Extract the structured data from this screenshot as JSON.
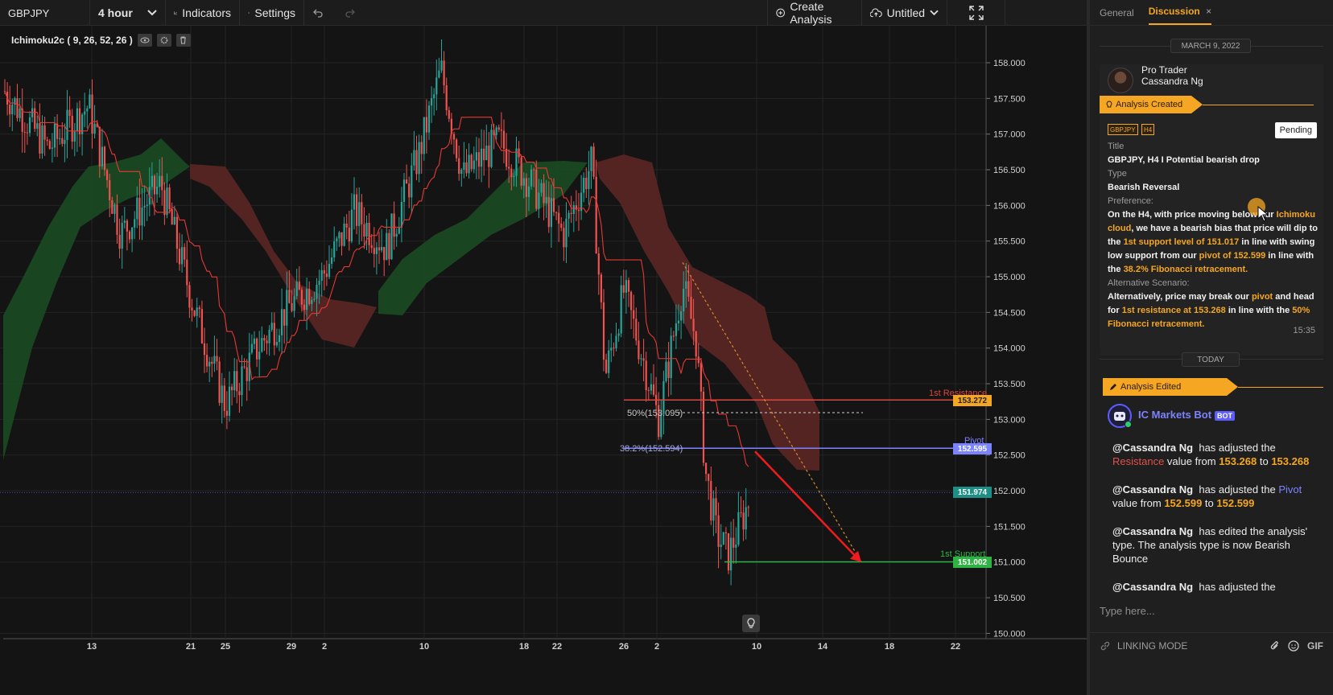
{
  "toolbar": {
    "symbol": "GBPJPY",
    "interval": "4 hour",
    "indicators_label": "Indicators",
    "settings_label": "Settings",
    "create_analysis_label": "Create Analysis",
    "layout_name": "Untitled"
  },
  "indicator": {
    "name": "Ichimoku2c ( 9, 26, 52, 26 )"
  },
  "chart_data": {
    "type": "candlestick",
    "symbol": "GBPJPY",
    "interval": "4 hour",
    "price_axis": [
      "158.000",
      "157.500",
      "157.000",
      "156.500",
      "156.000",
      "155.500",
      "155.000",
      "154.500",
      "154.000",
      "153.500",
      "153.000",
      "152.500",
      "152.000",
      "151.500",
      "151.000",
      "150.500",
      "150.000"
    ],
    "price_axis_values": [
      158.0,
      157.5,
      157.0,
      156.5,
      156.0,
      155.5,
      155.0,
      154.5,
      154.0,
      153.5,
      153.0,
      152.5,
      152.0,
      151.5,
      151.0,
      150.5,
      150.0
    ],
    "ylim": [
      149.93,
      158.11
    ],
    "date_axis": [
      "13",
      "21",
      "25",
      "29",
      "2",
      "10",
      "18",
      "22",
      "26",
      "2",
      "10",
      "14",
      "18",
      "22"
    ],
    "price_tags": {
      "resistance": "153.272",
      "pivot": "152.595",
      "current": "151.974",
      "support": "151.002"
    },
    "levels": {
      "resistance": {
        "label": "1st Resistance",
        "value": 153.272,
        "color": "#d9463d"
      },
      "pivot": {
        "label": "Pivot",
        "value": 152.595,
        "color": "#7c83ff"
      },
      "support": {
        "label": "1st Support",
        "value": 151.002,
        "color": "#2fb344"
      },
      "fib_50": {
        "label": "50%(153.095)",
        "value": 153.095
      },
      "fib_382": {
        "label": "38.2%(152.594)",
        "value": 152.594
      }
    },
    "colors": {
      "up": "#26a69a",
      "down": "#ef5350",
      "kumo_bull": "#1b4a22",
      "kumo_bear": "#5a2624"
    }
  },
  "panel": {
    "tabs": [
      "General",
      "Discussion"
    ],
    "date_divider": "MARCH 9, 2022",
    "author_role": "Pro Trader",
    "author_name": "Cassandra Ng",
    "banner_created": "Analysis Created",
    "tag_symbol": "GBPJPY",
    "tag_tf": "H4",
    "status": "Pending",
    "title_label": "Title",
    "title_value": "GBPJPY, H4 I Potential bearish drop",
    "type_label": "Type",
    "type_value": "Bearish Reversal",
    "preference_label": "Preference:",
    "alt_label": "Alternative Scenario:",
    "time": "15:35",
    "today_divider": "TODAY",
    "banner_edited": "Analysis Edited",
    "bot_name": "IC Markets Bot",
    "bot_badge": "BOT",
    "composer_placeholder": "Type here...",
    "linking_mode": "LINKING MODE",
    "gif": "GIF"
  }
}
